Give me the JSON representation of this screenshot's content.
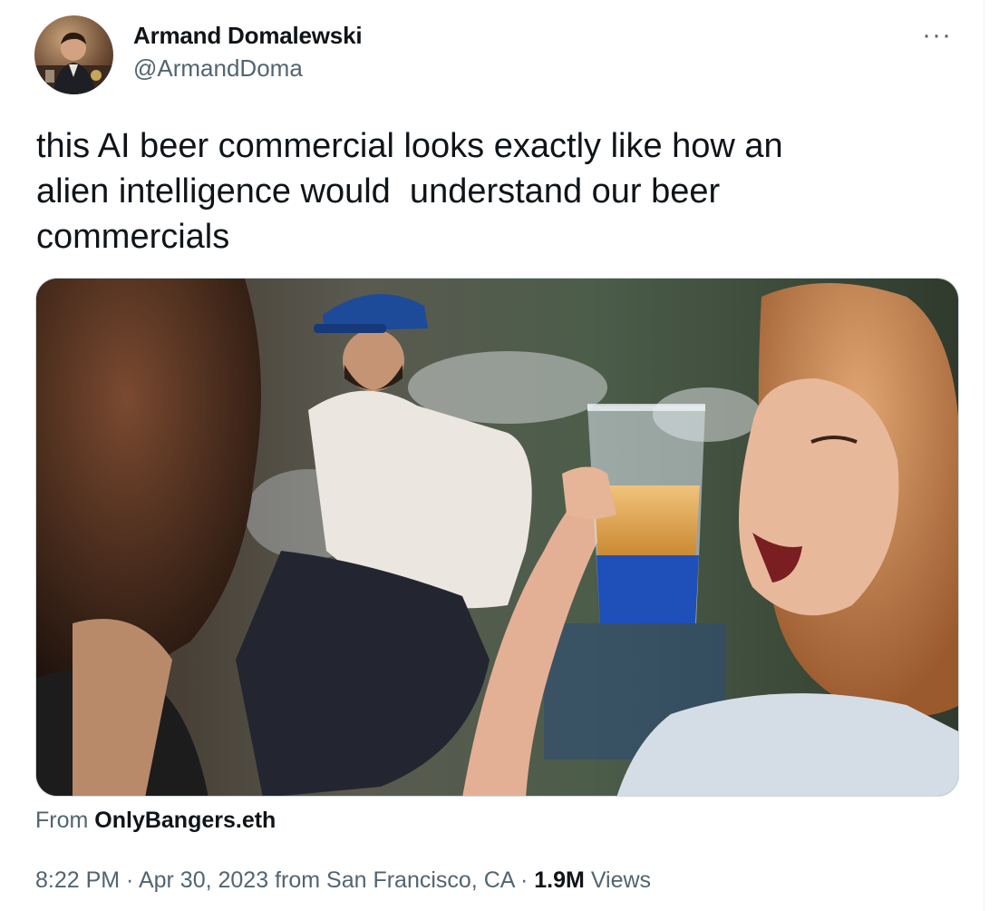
{
  "author": {
    "display_name": "Armand Domalewski",
    "handle": "@ArmandDoma",
    "avatar_icon": "profile-photo"
  },
  "more_icon": "ellipsis-icon",
  "more_label": "···",
  "tweet": {
    "text": "this AI beer commercial looks exactly like how an\nalien intelligence would  understand our beer\ncommercials"
  },
  "media": {
    "type": "video-still",
    "description_icon": "video-thumbnail"
  },
  "source": {
    "prefix": "From ",
    "name": "OnlyBangers.eth"
  },
  "meta": {
    "time": "8:22 PM",
    "sep1": " · ",
    "date": "Apr 30, 2023",
    "location": " from San Francisco, CA",
    "sep2": " · ",
    "views_count": "1.9M",
    "views_label": " Views"
  },
  "colors": {
    "text_primary": "#0f1419",
    "text_secondary": "#536471",
    "border": "#cfd9de"
  }
}
